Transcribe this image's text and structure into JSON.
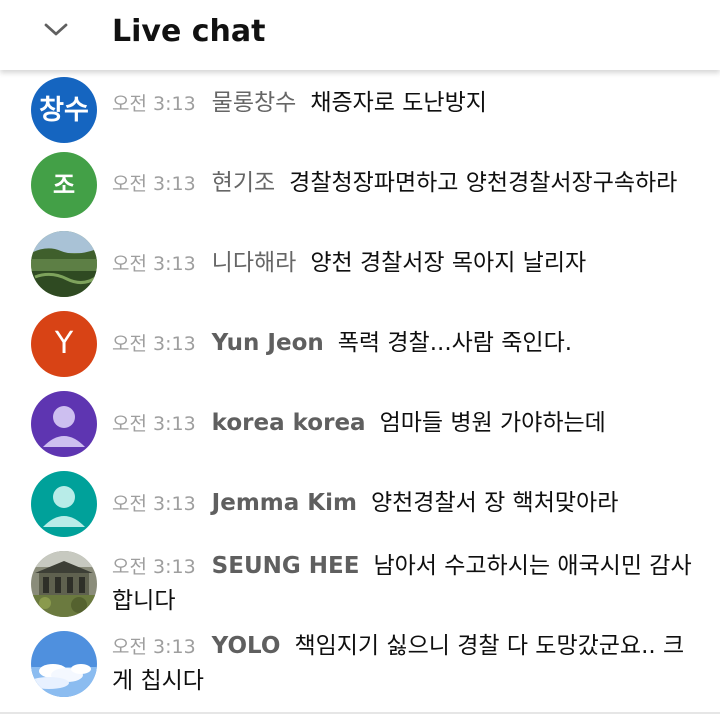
{
  "header": {
    "title": "Live chat"
  },
  "messages": [
    {
      "timestamp": "오전 3:13",
      "author": "물롱창수",
      "text": "채증자로 도난방지",
      "avatar_text": "창수",
      "avatar_color": "#1565c0"
    },
    {
      "timestamp": "오전 3:13",
      "author": "현기조",
      "text": "경찰청장파면하고 양천경찰서장구속하라",
      "avatar_text": "조",
      "avatar_color": "#43a047"
    },
    {
      "timestamp": "오전 3:13",
      "author": "니다해라",
      "text": "양천 경찰서장 목아지 날리자",
      "avatar_text": "",
      "avatar_color": "#4e6b3a"
    },
    {
      "timestamp": "오전 3:13",
      "author": "Yun Jeon",
      "text": "폭력 경찰...사람 죽인다.",
      "avatar_text": "Y",
      "avatar_color": "#d84315"
    },
    {
      "timestamp": "오전 3:13",
      "author": "korea korea",
      "text": "엄마들 병원 가야하는데",
      "avatar_text": "",
      "avatar_color": "#5e35b1"
    },
    {
      "timestamp": "오전 3:13",
      "author": "Jemma Kim",
      "text": "양천경찰서 장 핵처맞아라",
      "avatar_text": "",
      "avatar_color": "#00a19a"
    },
    {
      "timestamp": "오전 3:13",
      "author": "SEUNG HEE",
      "text": "남아서 수고하시는 애국시민 감사합니다",
      "avatar_text": "",
      "avatar_color": "#5b5f4c"
    },
    {
      "timestamp": "오전 3:13",
      "author": "YOLO",
      "text": "책임지기 싫으니 경찰 다 도망갔군요.. 크게 칩시다",
      "avatar_text": "",
      "avatar_color": "#6fa8e6"
    }
  ]
}
